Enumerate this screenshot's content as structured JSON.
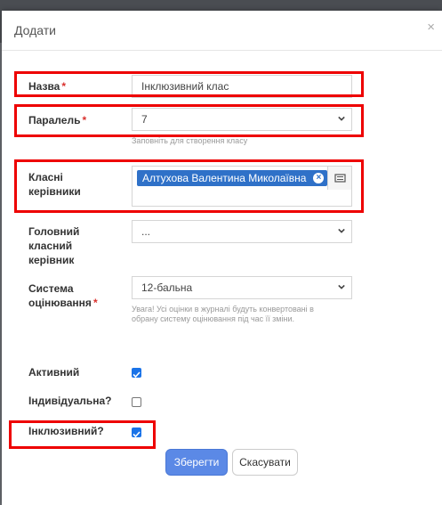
{
  "dialog": {
    "title": "Додати",
    "close_glyph": "×"
  },
  "form": {
    "name": {
      "label": "Назва",
      "required": "*",
      "value": "Інклюзивний клас"
    },
    "parallel": {
      "label": "Паралель",
      "required": "*",
      "value": "7",
      "hint": "Заповніть для створення класу"
    },
    "class_teachers": {
      "label_line1": "Класні",
      "label_line2": "керівники",
      "tags": [
        "Алтухова Валентина Миколаївна"
      ],
      "remove_glyph": "×"
    },
    "head_teacher": {
      "label_line1": "Головний",
      "label_line2": "класний",
      "label_line3": "керівник",
      "value": "..."
    },
    "grading": {
      "label_line1": "Система",
      "label_line2": "оцінювання",
      "required": "*",
      "value": "12-бальна",
      "hint_line1": "Увага! Усі оцінки в журналі будуть конвертовані в",
      "hint_line2": "обрану систему оцінювання під час її зміни."
    },
    "active": {
      "label": "Активний",
      "checked": true
    },
    "individual": {
      "label": "Індивідуальна?",
      "checked": false
    },
    "inclusive": {
      "label": "Інклюзивний?",
      "checked": true
    }
  },
  "buttons": {
    "save": "Зберегти",
    "cancel": "Скасувати"
  },
  "icons": {
    "close": "close-icon",
    "dropdown": "chevron-down-icon",
    "list": "list-icon",
    "check": "checkmark-icon"
  },
  "colors": {
    "accent": "#2f71c8",
    "save_button": "#5b89e6",
    "required": "#d9302c",
    "highlight": "#ee0000"
  }
}
